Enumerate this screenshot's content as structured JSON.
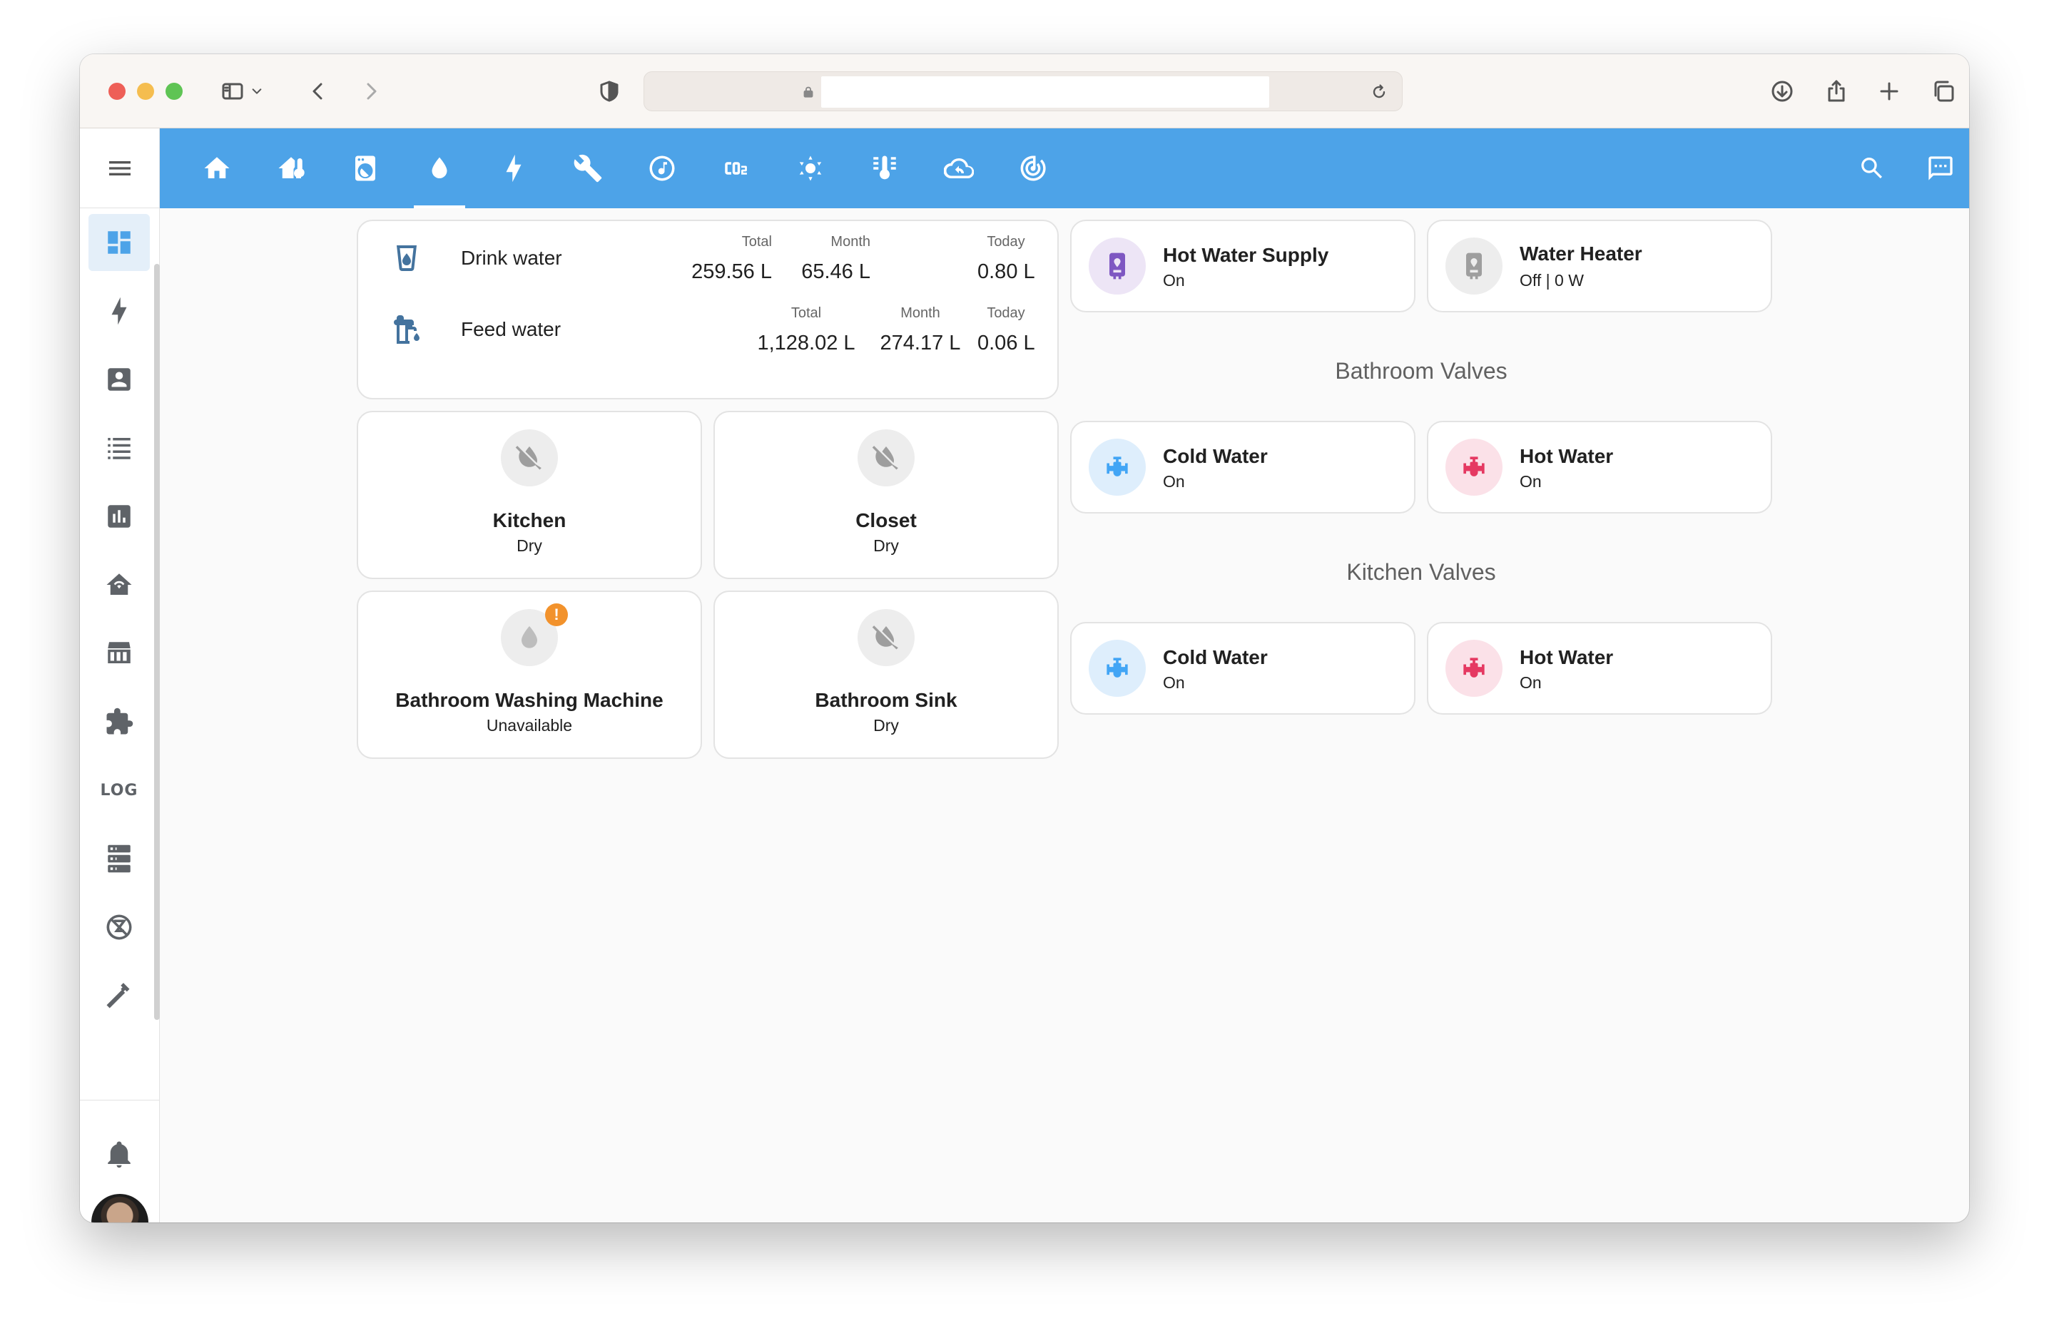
{
  "browser": {
    "window_controls": [
      "close",
      "minimize",
      "zoom"
    ],
    "toolbar_icons": [
      "sidebar-toggle-icon",
      "chevron-down-icon",
      "back-icon",
      "forward-icon",
      "shield-icon",
      "lock-icon",
      "reload-icon",
      "download-icon",
      "share-icon",
      "new-tab-icon",
      "tabs-overview-icon"
    ],
    "url": ""
  },
  "header": {
    "accent_color": "#4da3e8",
    "tabs": [
      {
        "icon": "home-icon"
      },
      {
        "icon": "home-thermometer-icon"
      },
      {
        "icon": "washing-machine-icon"
      },
      {
        "icon": "water-drop-icon",
        "active": true
      },
      {
        "icon": "lightning-bolt-icon"
      },
      {
        "icon": "wrench-icon"
      },
      {
        "icon": "music-note-icon"
      },
      {
        "icon": "co2-icon"
      },
      {
        "icon": "sun-wireless-icon"
      },
      {
        "icon": "thermometer-lines-icon"
      },
      {
        "icon": "cloud-sync-icon"
      },
      {
        "icon": "radar-icon"
      }
    ],
    "actions": [
      "search-icon",
      "assist-icon",
      "more-vert-icon"
    ]
  },
  "sidebar": {
    "items": [
      {
        "icon": "dashboard-icon",
        "active": true
      },
      {
        "icon": "energy-icon"
      },
      {
        "icon": "person-card-icon"
      },
      {
        "icon": "list-icon"
      },
      {
        "icon": "history-chart-icon"
      },
      {
        "icon": "home-network-icon"
      },
      {
        "icon": "hacs-icon",
        "label": "HACS"
      },
      {
        "icon": "puzzle-icon"
      },
      {
        "label": "LOG"
      },
      {
        "icon": "server-icon"
      },
      {
        "icon": "zwave-icon"
      },
      {
        "icon": "hammer-icon"
      }
    ],
    "notifications_icon": "bell-icon"
  },
  "water_usage": {
    "rows": [
      {
        "name": "Drink water",
        "icon": "cup-water-icon",
        "total_label": "Total",
        "total": "259.56 L",
        "month_label": "Month",
        "month": "65.46 L",
        "today_label": "Today",
        "today": "0.80 L"
      },
      {
        "name": "Feed water",
        "icon": "water-pump-icon",
        "total_label": "Total",
        "total": "1,128.02 L",
        "month_label": "Month",
        "month": "274.17 L",
        "today_label": "Today",
        "today": "0.06 L"
      }
    ]
  },
  "leak_sensors": [
    {
      "name": "Kitchen",
      "state": "Dry",
      "icon": "water-off-icon"
    },
    {
      "name": "Closet",
      "state": "Dry",
      "icon": "water-off-icon"
    },
    {
      "name": "Bathroom Washing Machine",
      "state": "Unavailable",
      "icon": "water-icon",
      "badge": "!"
    },
    {
      "name": "Bathroom Sink",
      "state": "Dry",
      "icon": "water-off-icon"
    }
  ],
  "heaters": [
    {
      "name": "Hot Water Supply",
      "state": "On",
      "icon": "water-boiler-icon",
      "color": "#7e57c2"
    },
    {
      "name": "Water Heater",
      "state": "Off | 0 W",
      "icon": "water-boiler-icon",
      "color": "#9e9e9e"
    }
  ],
  "sections": {
    "bathroom_title": "Bathroom Valves",
    "kitchen_title": "Kitchen Valves"
  },
  "bathroom_valves": [
    {
      "name": "Cold Water",
      "state": "On",
      "icon": "valve-icon",
      "color": "#42a5f5"
    },
    {
      "name": "Hot Water",
      "state": "On",
      "icon": "valve-icon",
      "color": "#e53962"
    }
  ],
  "kitchen_valves": [
    {
      "name": "Cold Water",
      "state": "On",
      "icon": "valve-icon",
      "color": "#42a5f5"
    },
    {
      "name": "Hot Water",
      "state": "On",
      "icon": "valve-icon",
      "color": "#e53962"
    }
  ]
}
